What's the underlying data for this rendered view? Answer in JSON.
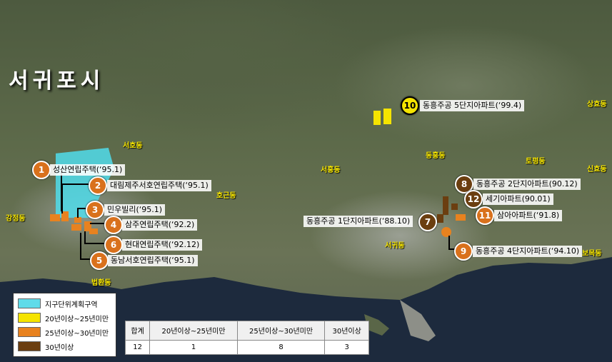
{
  "map": {
    "region_title": "서귀포시",
    "dong_labels": [
      {
        "id": "seoho",
        "text": "서호동"
      },
      {
        "id": "gangjeong",
        "text": "강정동"
      },
      {
        "id": "hogeun",
        "text": "호근동"
      },
      {
        "id": "beophwan",
        "text": "법환동"
      },
      {
        "id": "seohong",
        "text": "서홍동"
      },
      {
        "id": "donghong",
        "text": "동홍동"
      },
      {
        "id": "seogwi",
        "text": "서귀동"
      },
      {
        "id": "tohyeong",
        "text": "토평동"
      },
      {
        "id": "sanghyo",
        "text": "상효동"
      },
      {
        "id": "sinhyo",
        "text": "신효동"
      },
      {
        "id": "bomok",
        "text": "보목동"
      }
    ],
    "complexes": [
      {
        "no": "1",
        "label": "성산연립주택(‘95.1)",
        "category": "25-30"
      },
      {
        "no": "2",
        "label": "대림제주서호연립주택(‘95.1)",
        "category": "25-30"
      },
      {
        "no": "3",
        "label": "민우빌리(‘95.1)",
        "category": "25-30"
      },
      {
        "no": "4",
        "label": "삼주연립주택(‘92.2)",
        "category": "25-30"
      },
      {
        "no": "6",
        "label": "현대연립주택(‘92.12)",
        "category": "25-30"
      },
      {
        "no": "5",
        "label": "동남서호연립주택(‘95.1)",
        "category": "25-30"
      },
      {
        "no": "10",
        "label": "동흥주공 5단지아파트(‘99.4)",
        "category": "20-25"
      },
      {
        "no": "8",
        "label": "동흥주공 2단지아파트(90.12)",
        "category": "30+"
      },
      {
        "no": "12",
        "label": "세기아파트(90.01)",
        "category": "30+"
      },
      {
        "no": "7",
        "label": "동흥주공 1단지아파트(‘88.10)",
        "category": "30+"
      },
      {
        "no": "11",
        "label": "삼아아파트(‘91.8)",
        "category": "25-30"
      },
      {
        "no": "9",
        "label": "동흥주공 4단지아파트(‘94.10)",
        "category": "25-30"
      }
    ]
  },
  "legend": {
    "items": [
      {
        "label": "지구단위계획구역",
        "color": "#5fdbe9"
      },
      {
        "label": "20년이상~25년미만",
        "color": "#f5e400"
      },
      {
        "label": "25년이상~30년미만",
        "color": "#e8821f"
      },
      {
        "label": "30년이상",
        "color": "#6b3e10"
      }
    ]
  },
  "summary": {
    "headers": [
      "합계",
      "20년이상~25년미만",
      "25년이상~30년미만",
      "30년이상"
    ],
    "values": [
      "12",
      "1",
      "8",
      "3"
    ]
  },
  "colors": {
    "zone": "#5fdbe9",
    "age_20_25": "#f5e400",
    "age_25_30": "#e8821f",
    "age_30_plus": "#6b3e10",
    "sea": "#1d2a3d",
    "dong_label": "#f5e400"
  }
}
